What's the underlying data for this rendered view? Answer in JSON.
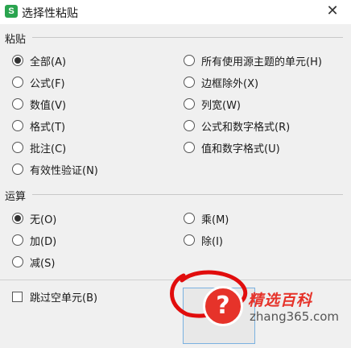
{
  "window": {
    "title": "选择性粘贴",
    "app_icon_letter": "S",
    "close_glyph": "✕"
  },
  "paste": {
    "label": "粘贴",
    "options": [
      {
        "label": "全部(A)",
        "checked": true
      },
      {
        "label": "所有使用源主题的单元(H)",
        "checked": false
      },
      {
        "label": "公式(F)",
        "checked": false
      },
      {
        "label": "边框除外(X)",
        "checked": false
      },
      {
        "label": "数值(V)",
        "checked": false
      },
      {
        "label": "列宽(W)",
        "checked": false
      },
      {
        "label": "格式(T)",
        "checked": false
      },
      {
        "label": "公式和数字格式(R)",
        "checked": false
      },
      {
        "label": "批注(C)",
        "checked": false
      },
      {
        "label": "值和数字格式(U)",
        "checked": false
      },
      {
        "label": "有效性验证(N)",
        "checked": false
      }
    ]
  },
  "operation": {
    "label": "运算",
    "options": [
      {
        "label": "无(O)",
        "checked": true
      },
      {
        "label": "乘(M)",
        "checked": false
      },
      {
        "label": "加(D)",
        "checked": false
      },
      {
        "label": "除(I)",
        "checked": false
      },
      {
        "label": "减(S)",
        "checked": false
      }
    ]
  },
  "skip_blanks": {
    "label": "跳过空单元(B)",
    "checked": false
  },
  "watermark": {
    "brand": "精选百科",
    "domain": "zhang365.com",
    "icon_glyph": "?"
  },
  "colors": {
    "accent": "#2aa44f",
    "watermark_red": "#e6332a",
    "button_border": "#7ab1e0"
  }
}
